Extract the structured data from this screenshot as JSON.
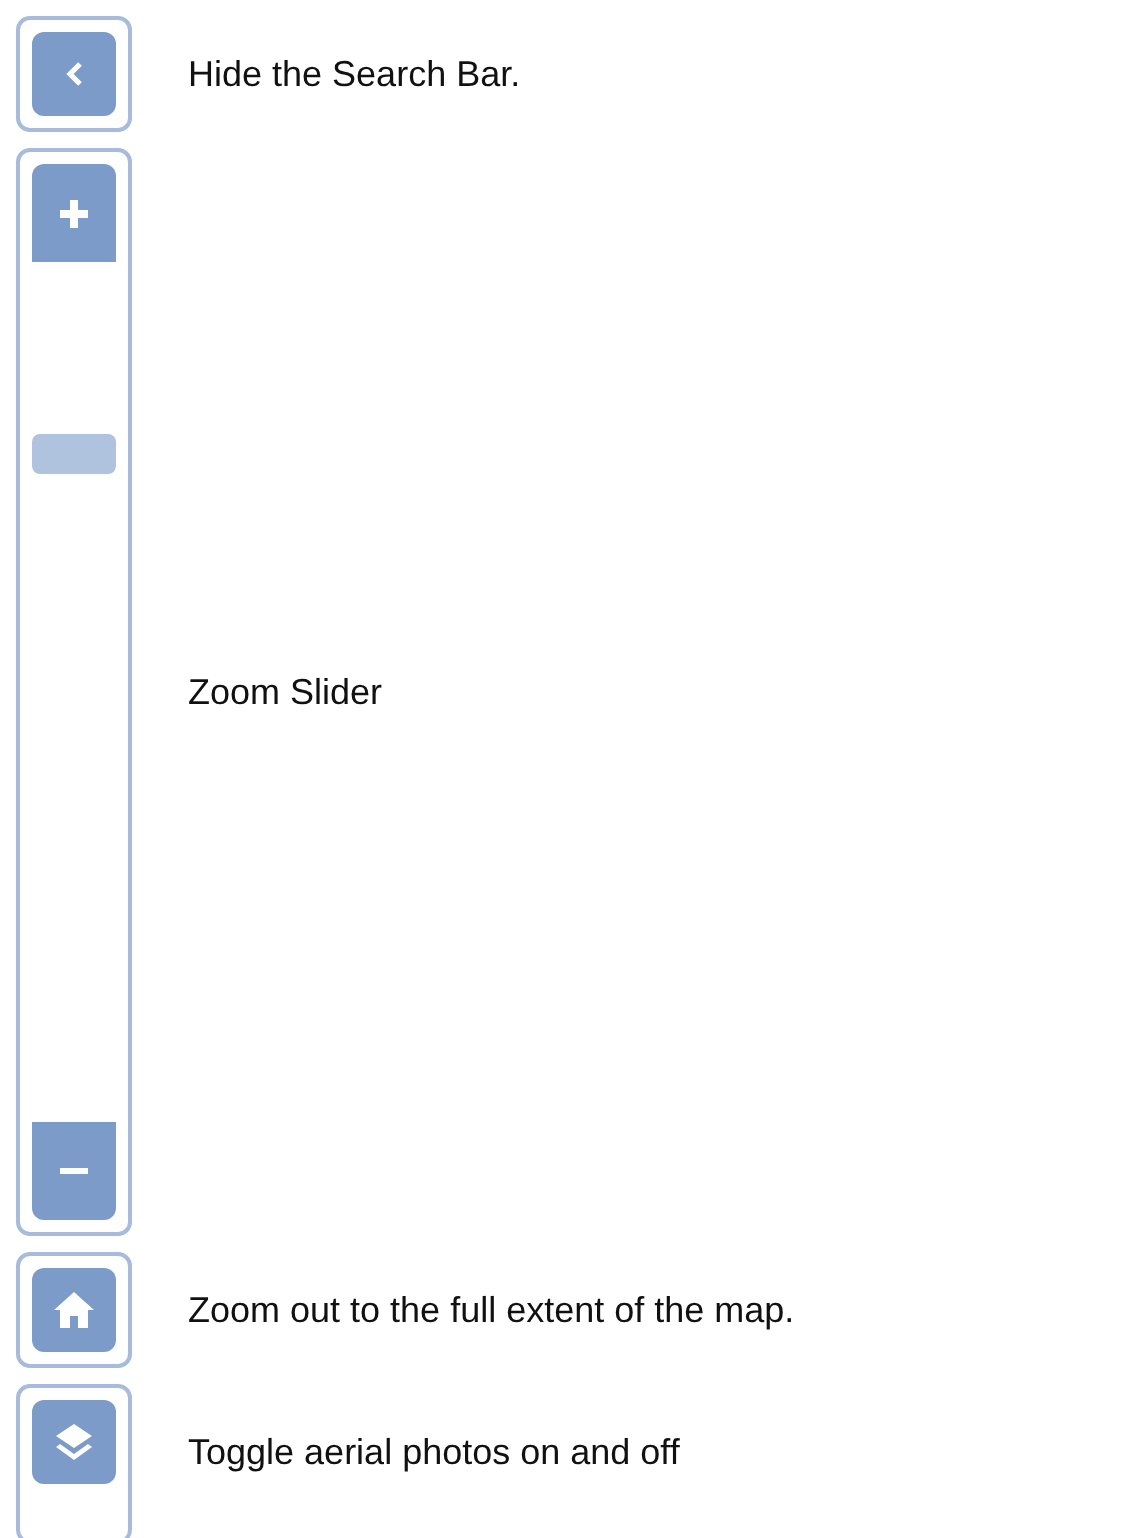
{
  "controls": [
    {
      "kind": "collapse",
      "description": "Hide the Search Bar."
    },
    {
      "kind": "slider",
      "level": 0.79,
      "description": "Zoom Slider"
    },
    {
      "kind": "home",
      "description": "Zoom out to the full extent of the map."
    },
    {
      "kind": "layers",
      "description": "Toggle aerial photos on and off"
    }
  ]
}
